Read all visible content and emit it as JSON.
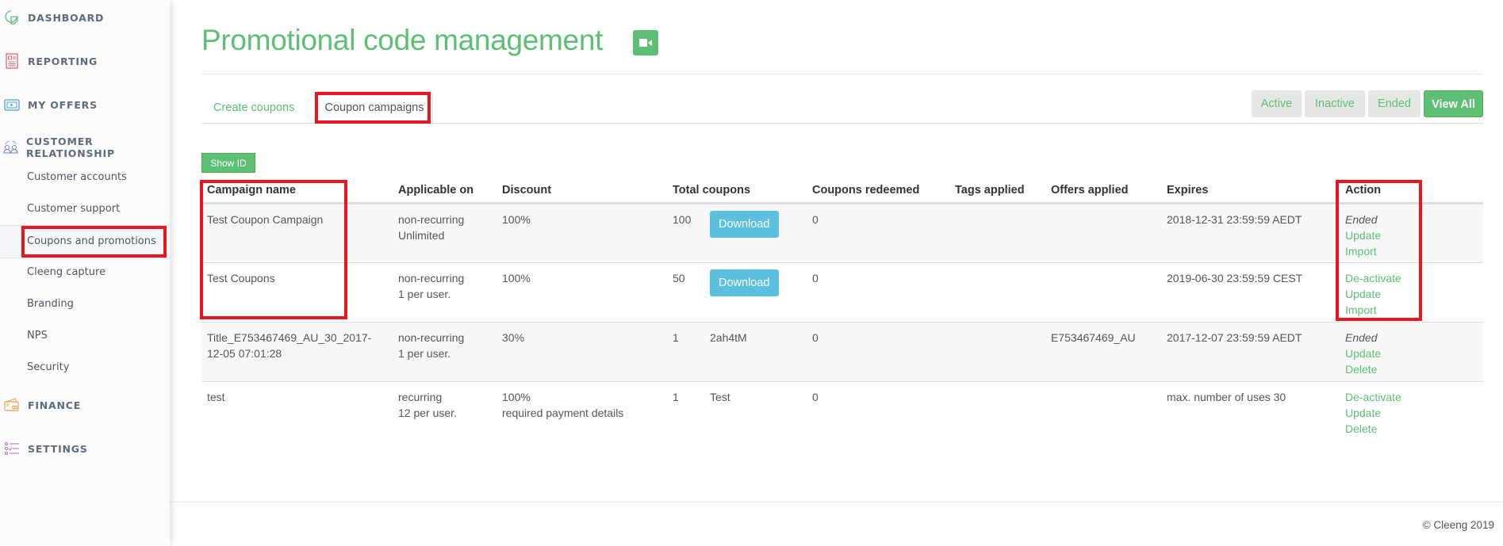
{
  "sidebar": {
    "sections": [
      {
        "label": "DASHBOARD",
        "icon": "dashboard-icon",
        "color": "#5cbf74"
      },
      {
        "label": "REPORTING",
        "icon": "report-icon",
        "color": "#e06a7a"
      },
      {
        "label": "MY OFFERS",
        "icon": "offers-icon",
        "color": "#4a9fe0"
      },
      {
        "label": "CUSTOMER RELATIONSHIP",
        "icon": "customers-icon",
        "color": "#6d7fb0"
      },
      {
        "label": "FINANCE",
        "icon": "finance-icon",
        "color": "#f0a050"
      },
      {
        "label": "SETTINGS",
        "icon": "settings-icon",
        "color": "#b070c0"
      }
    ],
    "sub_items": [
      {
        "label": "Customer accounts"
      },
      {
        "label": "Customer support"
      },
      {
        "label": "Coupons and promotions",
        "active": true
      },
      {
        "label": "Cleeng capture"
      },
      {
        "label": "Branding"
      },
      {
        "label": "NPS"
      },
      {
        "label": "Security"
      }
    ]
  },
  "header": {
    "title": "Promotional code management",
    "title_icon": "video-camera-icon"
  },
  "tabs": [
    {
      "label": "Create coupons",
      "active": false
    },
    {
      "label": "Coupon campaigns",
      "active": true
    }
  ],
  "filters": [
    {
      "label": "Active",
      "active": false
    },
    {
      "label": "Inactive",
      "active": false
    },
    {
      "label": "Ended",
      "active": false
    },
    {
      "label": "View All",
      "active": true
    }
  ],
  "show_id_label": "Show ID",
  "table": {
    "columns": [
      "Campaign name",
      "Applicable on",
      "Discount",
      "Total coupons",
      "Coupons redeemed",
      "Tags applied",
      "Offers applied",
      "Expires",
      "Action"
    ],
    "rows": [
      {
        "name": "Test Coupon Campaign",
        "applicable": [
          "non-recurring",
          "Unlimited"
        ],
        "discount": [
          "100%"
        ],
        "total": "100",
        "code": "Download",
        "code_is_button": true,
        "redeemed": "0",
        "tags": "",
        "offers": "",
        "expires": "2018-12-31 23:59:59 AEDT",
        "status": "Ended",
        "actions": [
          "Update",
          "Import"
        ]
      },
      {
        "name": "Test Coupons",
        "applicable": [
          "non-recurring",
          "1 per user."
        ],
        "discount": [
          "100%"
        ],
        "total": "50",
        "code": "Download",
        "code_is_button": true,
        "redeemed": "0",
        "tags": "",
        "offers": "",
        "expires": "2019-06-30 23:59:59 CEST",
        "status": "",
        "actions": [
          "De-activate",
          "Update",
          "Import"
        ]
      },
      {
        "name": "Title_E753467469_AU_30_2017-12-05 07:01:28",
        "applicable": [
          "non-recurring",
          "1 per user."
        ],
        "discount": [
          "30%"
        ],
        "total": "1",
        "code": "2ah4tM",
        "code_is_button": false,
        "redeemed": "0",
        "tags": "",
        "offers": "E753467469_AU",
        "expires": "2017-12-07 23:59:59 AEDT",
        "status": "Ended",
        "actions": [
          "Update",
          "Delete"
        ]
      },
      {
        "name": "test",
        "applicable": [
          "recurring",
          "12 per user."
        ],
        "discount": [
          "100%",
          "required payment details"
        ],
        "total": "1",
        "code": "Test",
        "code_is_button": false,
        "redeemed": "0",
        "tags": "",
        "offers": "",
        "expires": "max. number of uses 30",
        "status": "",
        "actions": [
          "De-activate",
          "Update",
          "Delete"
        ]
      }
    ]
  },
  "footer": {
    "copyright": "© Cleeng 2019"
  },
  "colors": {
    "brand_green": "#5cbf74",
    "download_blue": "#5bc0de",
    "highlight_red": "#e8161f"
  }
}
